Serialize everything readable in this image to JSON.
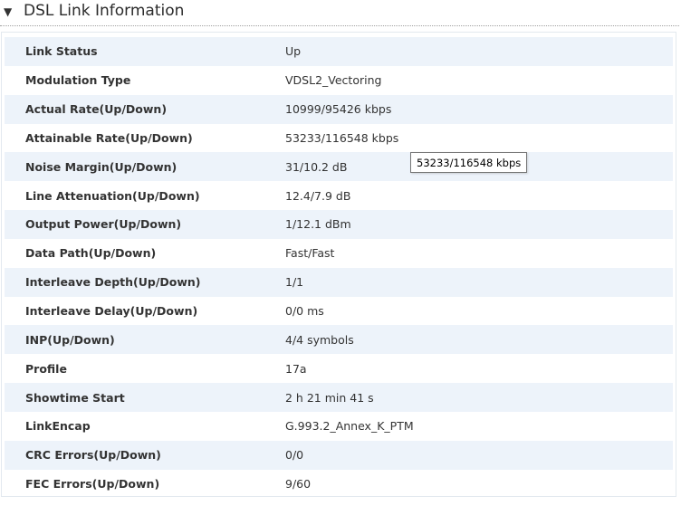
{
  "section": {
    "title": "DSL Link Information",
    "toggle_icon": "triangle-down-icon"
  },
  "rows": [
    {
      "label": "Link Status",
      "value": "Up"
    },
    {
      "label": "Modulation Type",
      "value": "VDSL2_Vectoring"
    },
    {
      "label": "Actual Rate(Up/Down)",
      "value": "10999/95426 kbps"
    },
    {
      "label": "Attainable Rate(Up/Down)",
      "value": "53233/116548 kbps"
    },
    {
      "label": "Noise Margin(Up/Down)",
      "value": "31/10.2 dB"
    },
    {
      "label": "Line Attenuation(Up/Down)",
      "value": "12.4/7.9 dB"
    },
    {
      "label": "Output Power(Up/Down)",
      "value": "1/12.1 dBm"
    },
    {
      "label": "Data Path(Up/Down)",
      "value": "Fast/Fast"
    },
    {
      "label": "Interleave Depth(Up/Down)",
      "value": "1/1"
    },
    {
      "label": "Interleave Delay(Up/Down)",
      "value": "0/0 ms"
    },
    {
      "label": "INP(Up/Down)",
      "value": "4/4 symbols"
    },
    {
      "label": "Profile",
      "value": "17a"
    },
    {
      "label": "Showtime Start",
      "value": "2 h 21 min 41 s"
    },
    {
      "label": "LinkEncap",
      "value": "G.993.2_Annex_K_PTM"
    },
    {
      "label": "CRC Errors(Up/Down)",
      "value": "0/0"
    },
    {
      "label": "FEC Errors(Up/Down)",
      "value": "9/60"
    }
  ],
  "tooltip": {
    "text": "53233/116548 kbps"
  },
  "colors": {
    "row_alt_background": "#edf3fa",
    "border": "#e3e9ef",
    "text": "#333333"
  }
}
